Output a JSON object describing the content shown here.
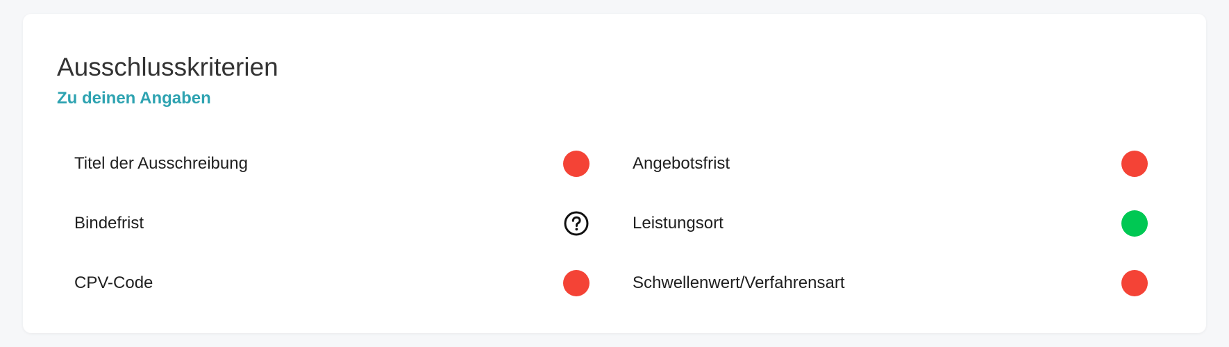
{
  "card": {
    "title": "Ausschlusskriterien",
    "link_label": "Zu deinen Angaben"
  },
  "colors": {
    "red": "#f44336",
    "green": "#00c853",
    "link": "#2ea3b1"
  },
  "criteria": [
    {
      "label": "Titel der Ausschreibung",
      "status": "red",
      "icon": "status-dot-red"
    },
    {
      "label": "Angebotsfrist",
      "status": "red",
      "icon": "status-dot-red"
    },
    {
      "label": "Bindefrist",
      "status": "unknown",
      "icon": "question-circle-icon"
    },
    {
      "label": "Leistungsort",
      "status": "green",
      "icon": "status-dot-green"
    },
    {
      "label": "CPV-Code",
      "status": "red",
      "icon": "status-dot-red"
    },
    {
      "label": "Schwellenwert/Verfahrensart",
      "status": "red",
      "icon": "status-dot-red"
    }
  ]
}
